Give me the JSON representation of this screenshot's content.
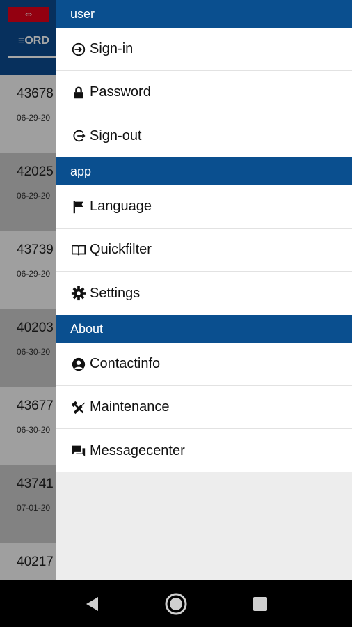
{
  "background": {
    "logo_text": "⇔",
    "tab_label": "ORD",
    "rows": [
      {
        "number": "43678",
        "date": "06-29-20"
      },
      {
        "number": "42025",
        "date": "06-29-20"
      },
      {
        "number": "43739",
        "date": "06-29-20"
      },
      {
        "number": "40203",
        "date": "06-30-20"
      },
      {
        "number": "43677",
        "date": "06-30-20"
      },
      {
        "number": "43741",
        "date": "07-01-20"
      },
      {
        "number": "40217",
        "date": ""
      }
    ]
  },
  "drawer": {
    "sections": [
      {
        "title": "user",
        "items": [
          {
            "label": "Sign-in",
            "icon": "sign-in-icon"
          },
          {
            "label": "Password",
            "icon": "lock-icon"
          },
          {
            "label": "Sign-out",
            "icon": "sign-out-icon"
          }
        ]
      },
      {
        "title": "app",
        "items": [
          {
            "label": "Language",
            "icon": "flag-icon"
          },
          {
            "label": "Quickfilter",
            "icon": "book-icon"
          },
          {
            "label": "Settings",
            "icon": "gear-icon"
          }
        ]
      },
      {
        "title": "About",
        "items": [
          {
            "label": "Contactinfo",
            "icon": "user-circle-icon"
          },
          {
            "label": "Maintenance",
            "icon": "tools-icon"
          },
          {
            "label": "Messagecenter",
            "icon": "chat-icon"
          }
        ]
      }
    ]
  },
  "colors": {
    "header_blue": "#0a4f8f",
    "brand_red": "#e2001a"
  }
}
